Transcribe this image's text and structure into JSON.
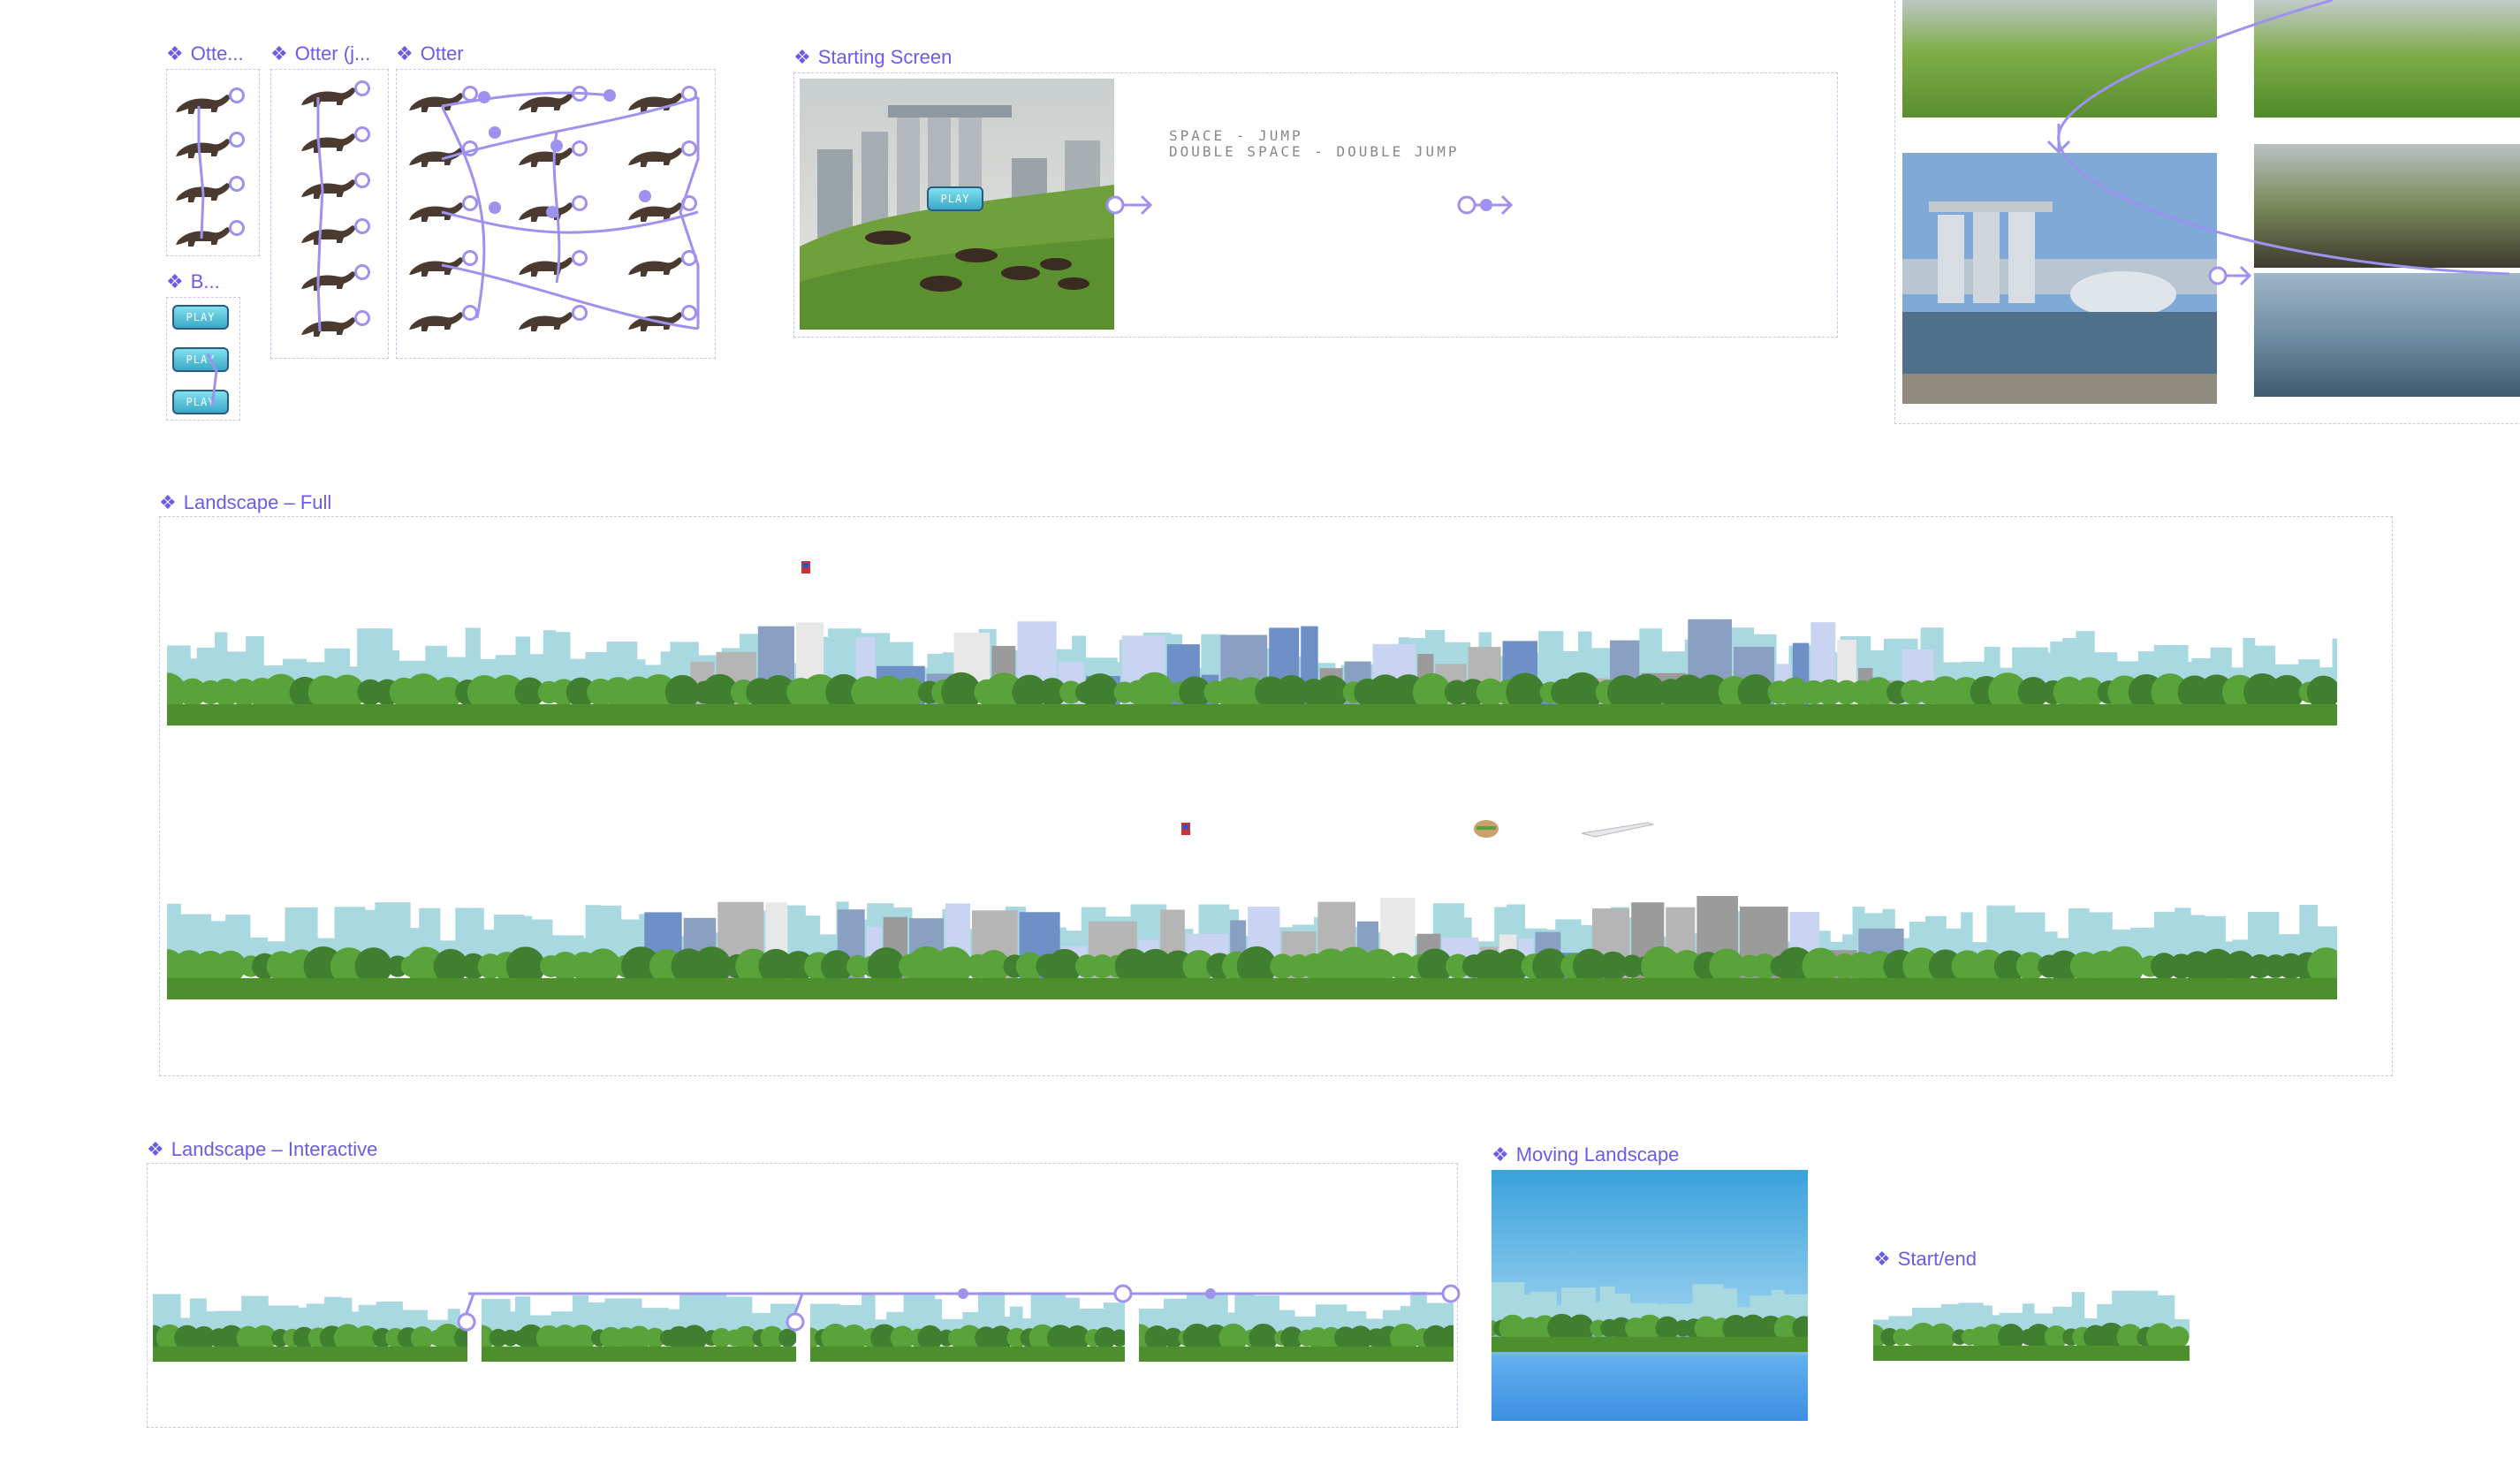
{
  "frames": {
    "otter_small": "Otte...",
    "otter_jump": "Otter (j...",
    "otter": "Otter",
    "button": "B...",
    "starting_screen": "Starting Screen",
    "landscape_full": "Landscape – Full",
    "landscape_interactive": "Landscape – Interactive",
    "moving_landscape": "Moving Landscape",
    "start_end": "Start/end"
  },
  "component_icon": "❖",
  "play_label": "PLAY",
  "instructions": {
    "line1": "SPACE - JUMP",
    "line2": "DOUBLE SPACE - DOUBLE JUMP"
  },
  "icons": {
    "component": "component-diamond-icon",
    "otter": "otter-sprite-icon",
    "connector": "prototype-connector-icon"
  },
  "colors": {
    "accent": "#6b5ce7",
    "connector": "#9d92ee",
    "frame_border": "#c9c5f0",
    "sky": "#4aa7e0",
    "grass": "#5aa33a",
    "tree": "#3f7f2f"
  }
}
